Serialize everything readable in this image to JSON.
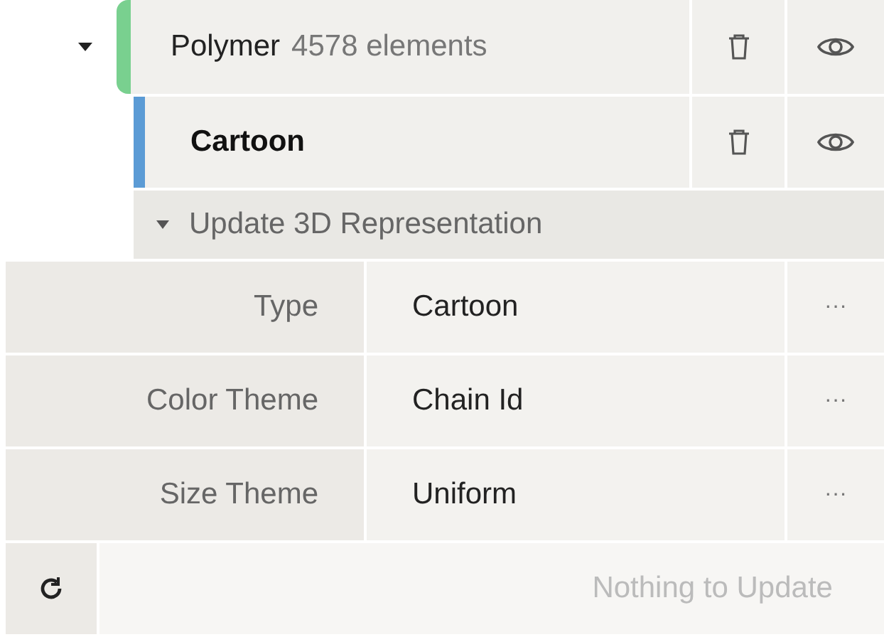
{
  "structure": {
    "expanded": true,
    "label": "Polymer",
    "count": "4578 elements",
    "color": "#79d08f"
  },
  "representation": {
    "label": "Cartoon",
    "color": "#5b9bd5"
  },
  "update_panel": {
    "title": "Update 3D Representation",
    "expanded": true
  },
  "params": [
    {
      "label": "Type",
      "value": "Cartoon",
      "more": "···"
    },
    {
      "label": "Color Theme",
      "value": "Chain Id",
      "more": "···"
    },
    {
      "label": "Size Theme",
      "value": "Uniform",
      "more": "···"
    }
  ],
  "apply_button": {
    "label": "Nothing to Update",
    "disabled": true
  }
}
